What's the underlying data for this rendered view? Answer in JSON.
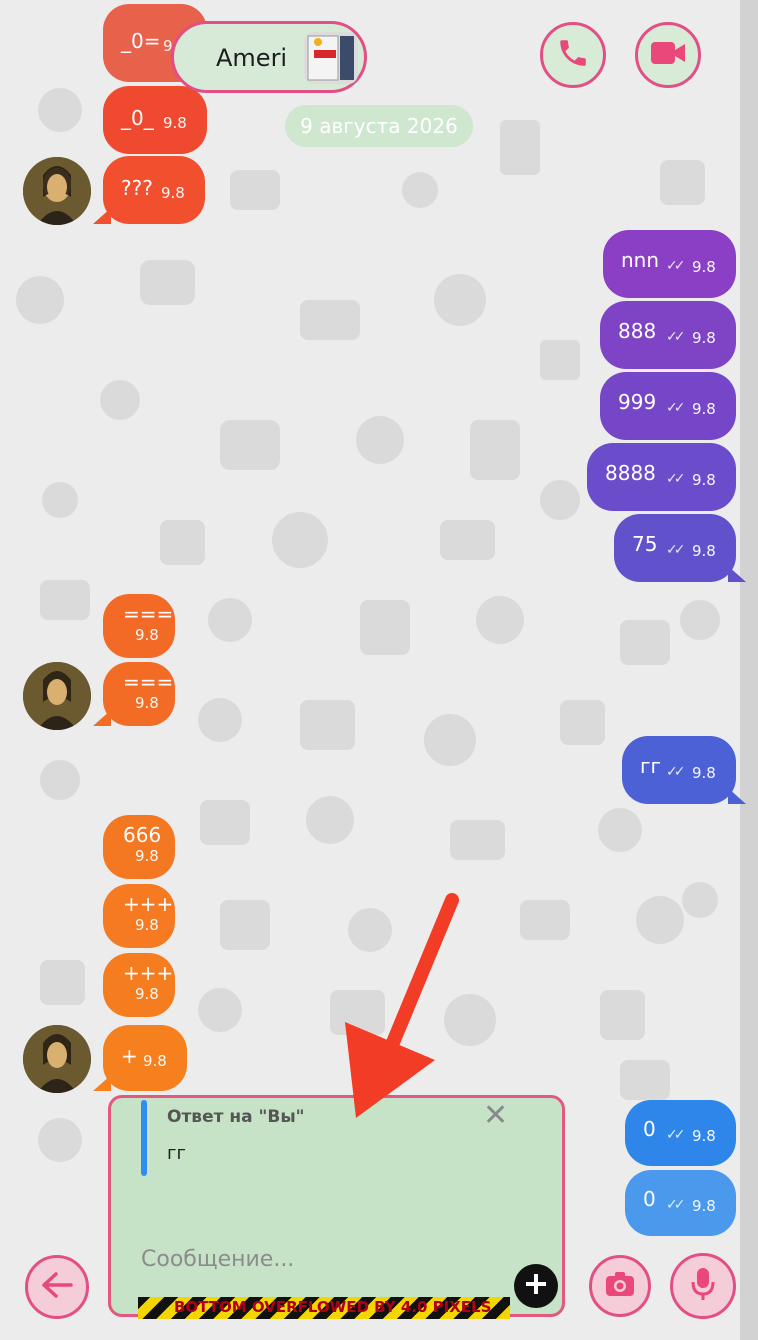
{
  "header": {
    "contact_name": "Ameri",
    "date_label": "9 августа 2026"
  },
  "messages": [
    {
      "side": "in",
      "text": "_0=",
      "time": "9.8",
      "color": "#e8492f"
    },
    {
      "side": "in",
      "text": "_0_",
      "time": "9.8",
      "color": "#ef4a2f"
    },
    {
      "side": "in",
      "text": "???",
      "time": "9.8",
      "color": "#f14f2e"
    },
    {
      "side": "out",
      "text": "nnn",
      "time": "9.8",
      "color": "#8a3fc4"
    },
    {
      "side": "out",
      "text": "888",
      "time": "9.8",
      "color": "#7f43c6"
    },
    {
      "side": "out",
      "text": "999",
      "time": "9.8",
      "color": "#7547c8"
    },
    {
      "side": "out",
      "text": "8888",
      "time": "9.8",
      "color": "#6b4cca"
    },
    {
      "side": "out",
      "text": "75",
      "time": "9.8",
      "color": "#6152cc"
    },
    {
      "side": "in",
      "text": "===",
      "time": "9.8",
      "color": "#f36a27"
    },
    {
      "side": "in",
      "text": "===",
      "time": "9.8",
      "color": "#f36c26"
    },
    {
      "side": "out",
      "text": "гг",
      "time": "9.8",
      "color": "#4d61d6"
    },
    {
      "side": "in",
      "text": "666",
      "time": "9.8",
      "color": "#f47722"
    },
    {
      "side": "in",
      "text": "+++",
      "time": "9.8",
      "color": "#f57a21"
    },
    {
      "side": "in",
      "text": "+++",
      "time": "9.8",
      "color": "#f57d20"
    },
    {
      "side": "in",
      "text": "+",
      "time": "9.8",
      "color": "#f6801e"
    },
    {
      "side": "out",
      "text": "0",
      "time": "9.8",
      "color": "#2e86ea"
    },
    {
      "side": "out",
      "text": "0",
      "time": "9.8",
      "color": "#2e8bec"
    }
  ],
  "composer": {
    "reply_title": "Ответ на \"Вы\"",
    "reply_text": "гг",
    "placeholder": "Сообщение..."
  },
  "debug": {
    "overflow_text": "BOTTOM OVERFLOWED BY 4.0 PIXELS"
  },
  "icons": {
    "call": "phone-icon",
    "video": "video-camera-icon",
    "back": "arrow-left-icon",
    "camera": "camera-icon",
    "mic": "microphone-icon",
    "attach": "plus-icon",
    "close": "close-icon"
  },
  "colors": {
    "accent_pink": "#e24f86",
    "button_bg": "#d7ebd6",
    "composer_bg": "#c6e2c7",
    "annotation_arrow": "#f23c25"
  }
}
